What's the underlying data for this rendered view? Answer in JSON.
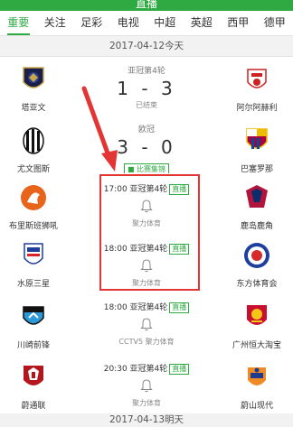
{
  "header": {
    "title": "直播"
  },
  "tabs": [
    "重要",
    "关注",
    "足彩",
    "电视",
    "中超",
    "英超",
    "西甲",
    "德甲"
  ],
  "dates": {
    "today": "2017-04-12今天",
    "tomorrow": "2017-04-13明天"
  },
  "matches": [
    {
      "home": "塔亚文",
      "away": "阿尔阿赫利",
      "league": "亚冠第4轮",
      "score": "1 - 3",
      "status": "已结束"
    },
    {
      "home": "尤文图斯",
      "away": "巴塞罗那",
      "league": "欧冠",
      "score": "3 - 0",
      "replay": "比赛集锦"
    },
    {
      "home": "布里斯班狮吼",
      "away": "鹿岛鹿角",
      "time_league": "17:00 亚冠第4轮",
      "tag": "直播",
      "channel": "聚力体育"
    },
    {
      "home": "水原三星",
      "away": "东方体育会",
      "time_league": "18:00 亚冠第4轮",
      "tag": "直播",
      "channel": "聚力体育"
    },
    {
      "home": "川崎前锋",
      "away": "广州恒大淘宝",
      "time_league": "18:00 亚冠第4轮",
      "tag": "直播",
      "channel": "CCTV5 聚力体育"
    },
    {
      "home": "蔚通联",
      "away": "蔚山现代",
      "time_league": "20:30 亚冠第4轮",
      "tag": "直播",
      "channel": "聚力体育"
    }
  ],
  "colors": {
    "accent": "#2faa43",
    "highlight": "#e43535"
  }
}
